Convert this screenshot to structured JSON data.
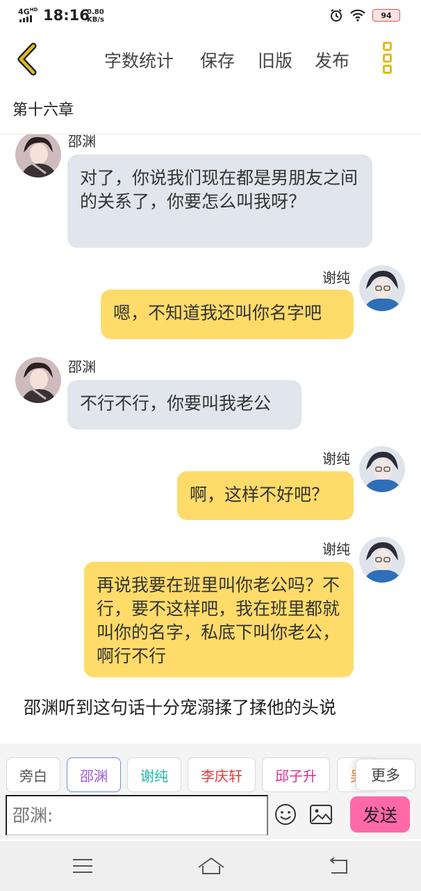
{
  "status_bar": {
    "network": "4G",
    "network_sup": "HD",
    "time": "18:16",
    "speed_value": "0.80",
    "speed_unit": "KB/s",
    "battery": "94"
  },
  "toolbar": {
    "back_icon": "chevron-left-icon",
    "word_count_label": "字数统计",
    "save_label": "保存",
    "old_version_label": "旧版",
    "publish_label": "发布",
    "menu_icon": "more-vertical-icon",
    "accent_color": "#e0bb1a"
  },
  "chapter_title": "第十六章",
  "messages": [
    {
      "side": "left",
      "name": "邵渊",
      "text": "对了，你说我们现在都是男朋友之间的关系了，你要怎么叫我呀？"
    },
    {
      "side": "right",
      "name": "谢纯",
      "text": "嗯，不知道我还叫你名字吧"
    },
    {
      "side": "left",
      "name": "邵渊",
      "text": "不行不行，你要叫我老公"
    },
    {
      "side": "right",
      "name": "谢纯",
      "text": "啊，这样不好吧？"
    },
    {
      "side": "right",
      "name": "谢纯",
      "text": "再说我要在班里叫你老公吗？不行，要不这样吧，我在班里都就叫你的名字，私底下叫你老公，啊行不行"
    }
  ],
  "narration": "邵渊听到这句话十分宠溺揉了揉他的头说",
  "characters": [
    {
      "label": "旁白",
      "color": "#555555"
    },
    {
      "label": "邵渊",
      "color": "#a05ad6",
      "selected": true
    },
    {
      "label": "谢纯",
      "color": "#1fb6a8"
    },
    {
      "label": "李庆轩",
      "color": "#e03a3a"
    },
    {
      "label": "邱子升",
      "color": "#d6328f"
    },
    {
      "label": "吴",
      "color": "#e8862a"
    }
  ],
  "more_label": "更多",
  "input": {
    "placeholder": "邵渊:"
  },
  "send_label": "发送",
  "colors": {
    "left_bubble": "#e1e5ec",
    "right_bubble": "#ffdb6a",
    "send_button": "#ff69a8"
  },
  "nav": {
    "menu_icon": "menu-icon",
    "home_icon": "home-icon",
    "back_icon": "back-icon"
  }
}
